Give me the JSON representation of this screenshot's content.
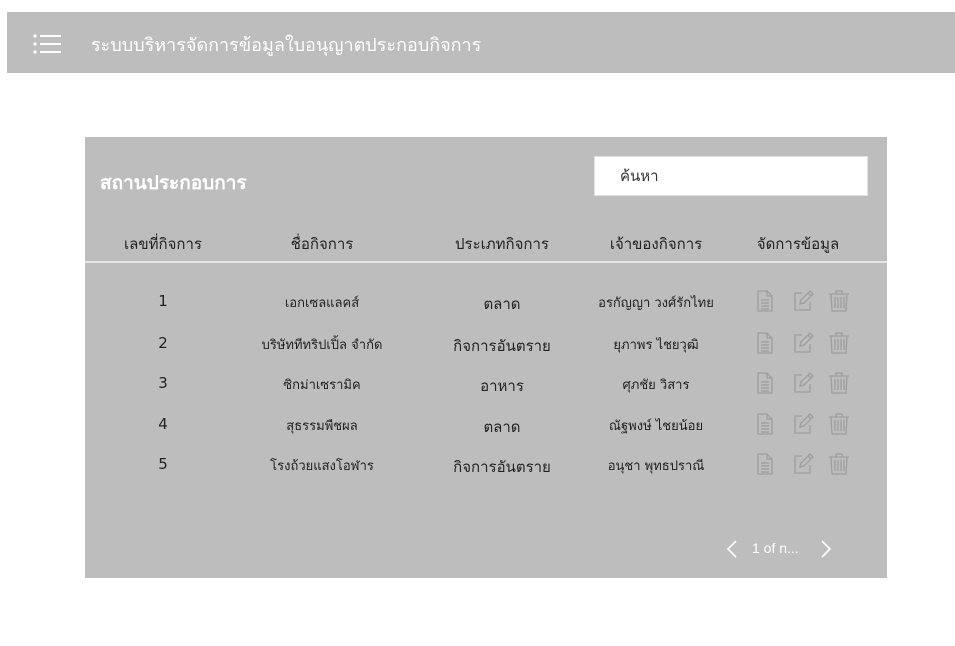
{
  "header": {
    "menu_icon": "hamburger-menu-icon",
    "title": "ระบบบริหารจัดการข้อมูลใบอนุญาตประกอบกิจการ"
  },
  "panel": {
    "title": "สถานประกอบการ",
    "search": {
      "placeholder": "ค้นหา"
    },
    "columns": [
      "เลขที่กิจการ",
      "ชื่อกิจการ",
      "ประเภทกิจการ",
      "เจ้าของกิจการ",
      "จัดการข้อมูล"
    ],
    "rows": [
      {
        "id": "1",
        "name": "เอกเซลแลคส์",
        "type": "ตลาด",
        "owner": "อรกัญญา  วงศ์รักไทย"
      },
      {
        "id": "2",
        "name": "บริษัททีทริปเปิ้ล จำกัด",
        "type": "กิจการอันตราย",
        "owner": "ยุภาพร  ไชยวุฒิ"
      },
      {
        "id": "3",
        "name": "ซิกม่าเซรามิค",
        "type": "อาหาร",
        "owner": "ศุภชัย   วิสาร"
      },
      {
        "id": "4",
        "name": "สุธรรมพืชผล",
        "type": "ตลาด",
        "owner": "ณัฐพงษ์   ไชยน้อย"
      },
      {
        "id": "5",
        "name": "โรงถ้วยแสงโอฬาร",
        "type": "กิจการอันตราย",
        "owner": "อนุชา   พุทธปราณี"
      }
    ],
    "row_actions": [
      "document-icon",
      "edit-icon",
      "trash-icon"
    ],
    "pagination": {
      "text": "1 of n..."
    }
  },
  "colors": {
    "bar": "#bdbdbd",
    "panel": "#bdbdbd",
    "icon": "#9e9e9e",
    "text": "#222222"
  }
}
